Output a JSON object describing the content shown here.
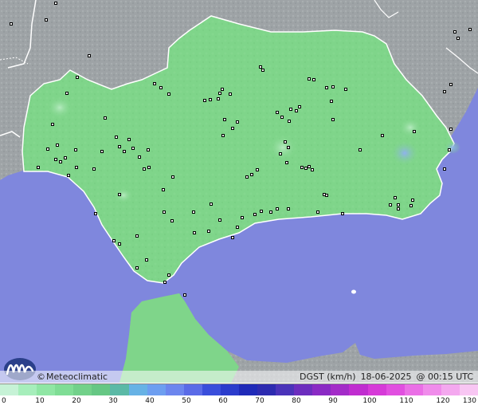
{
  "map": {
    "brand": "Meteoclimatic",
    "brand_mark": "©",
    "variable": "DGST (km/h)",
    "date": "18-06-2025",
    "time_label": "@ 00:15 UTC",
    "colors": {
      "sea": "#7f87dd",
      "land_other": "#9ea3a6",
      "region": "#7fd58a",
      "region_alt": "#89dc95",
      "calm_blue": "#8fb2ee",
      "border": "#ffffff",
      "station": "#ffffff"
    },
    "scale": {
      "ticks": [
        "0",
        "10",
        "20",
        "30",
        "40",
        "50",
        "60",
        "70",
        "80",
        "90",
        "100",
        "110",
        "120",
        "130"
      ],
      "colors": [
        "#c6f2d6",
        "#a6eebb",
        "#8fe6a4",
        "#7fdd95",
        "#72d18a",
        "#66c784",
        "#5bb9a6",
        "#67b2e5",
        "#6d9ef0",
        "#6c86ee",
        "#5a6be7",
        "#3a4edb",
        "#2b3ccc",
        "#1f2ab8",
        "#2d2bb0",
        "#4a33b9",
        "#6c2dbe",
        "#8a2ac4",
        "#a32cc8",
        "#c02dd0",
        "#d63ad8",
        "#e14fe0",
        "#ea6fe6",
        "#f08ceb",
        "#f4a8ef",
        "#f8c6f3"
      ]
    }
  }
}
